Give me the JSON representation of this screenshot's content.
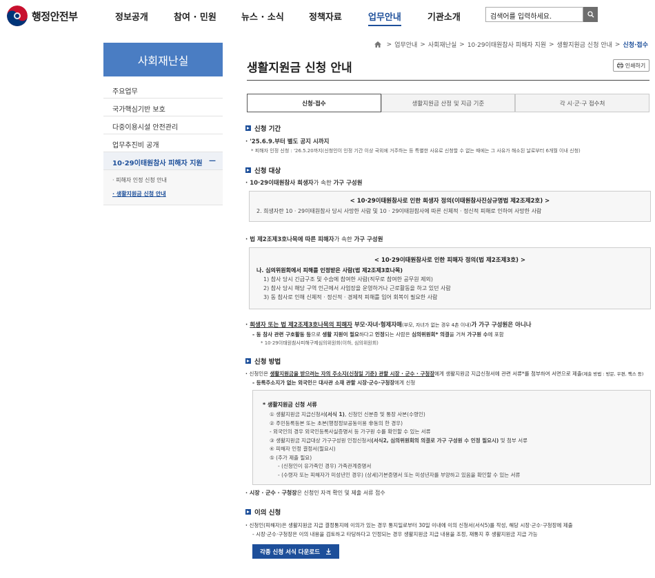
{
  "header": {
    "logo_text": "행정안전부",
    "nav": [
      "정보공개",
      "참여 · 민원",
      "뉴스 · 소식",
      "정책자료",
      "업무안내",
      "기관소개"
    ],
    "active_nav": "업무안내",
    "search_placeholder": "검색어를 입력하세요."
  },
  "sidebar": {
    "title": "사회재난실",
    "items": [
      "주요업무",
      "국가핵심기반 보호",
      "다중이용시설 안전관리",
      "업무추진비 공개"
    ],
    "active_item": "10·29이태원참사 피해자 지원",
    "active_toggle": "—",
    "sub_items": [
      "피해자 인정 신청 안내",
      "생활지원금 신청 안내"
    ]
  },
  "breadcrumb": {
    "items": [
      "업무안내",
      "사회재난실",
      "10·29이태원참사 피해자 지원",
      "생활지원금 신청 안내"
    ],
    "current": "신청·접수",
    "sep": ">"
  },
  "page": {
    "title": "생활지원금 신청 안내",
    "print_label": "인쇄하기"
  },
  "tabs": [
    "신청·접수",
    "생활지원금 산정 및 지급 기준",
    "각 시·군·구 접수처"
  ],
  "content": {
    "s1_title": "신청 기간",
    "s1_line1": "'25.6.9.부터 별도 공지 시까지",
    "s1_note": "* 피해자 인정 신청 : '26.5.20까지(신청인이 인정 기간 이상 국외에 거주하는 등 특별한 사유로 신청할 수 없는 때에는 그 사유가 해소된 날로부터 6개월 이내 신청)",
    "s2_title": "신청 대상",
    "s2_a_pre": "10·29이태원참사 희생자",
    "s2_a_mid": "가 속한 ",
    "s2_a_bold": "가구 구성원",
    "box1_head": "< 10·29이태원참사로 인한 희생자 정의(이태원참사진상규명법 제2조제2호) >",
    "box1_line": "2. 희생자란 10 · 29이태원참사 당시 사망한 사람 및 10 · 29이태원참사에 따른 신체적 · 정신적 피해로 인하여 사망한 사람",
    "s2_b_pre": "법 제2조제3호나목에 따른 피해자",
    "s2_b_mid": "가 속한 ",
    "s2_b_bold": "가구 구성원",
    "box2_head": "< 10·29이태원참사로 인한 피해자 정의(법 제2조제3호) >",
    "box2_l1": "나. 심의위원회에서 피해를 인정받은 사람(법 제2조제3호나목)",
    "box2_l2": "1) 참사 당시 긴급구조 및 수습에 참여한 사람(직무로 참여한 공무원 제외)",
    "box2_l3": "2) 참사 당시 해당 구역 인근에서 사업장을 운영하거나 근로활동을 하고 있던 사람",
    "box2_l4": "3) 동 참사로 인해 신체적 · 정신적 · 경제적 피해를 입어 회복이 필요한 사람",
    "s2_c_pre": "희생자 또는 법 제2조제3호나목의 피해자",
    "s2_c_mid": " 부모·자녀·형제자매",
    "s2_c_small": "(부모, 자녀가 없는 경우 4촌 이내)",
    "s2_c_end": "가 가구 구성원은 아니나",
    "s2_c_dash_1": "- 동 참사 관련 구호활동 등",
    "s2_c_dash_2": "으로 ",
    "s2_c_dash_3": "생활 지원이 필요",
    "s2_c_dash_4": "하다고 ",
    "s2_c_dash_5": "인정",
    "s2_c_dash_6": "되는 사람은 ",
    "s2_c_dash_7": "심의위원회* 의결",
    "s2_c_dash_8": "을 거쳐 ",
    "s2_c_dash_9": "가구원 수",
    "s2_c_dash_10": "에 포함",
    "s2_c_note": "* 10·29이태원참사피해구제심의위원회(이하, 심의위원회)",
    "s3_title": "신청 방법",
    "s3_l1_a": "신청인은 ",
    "s3_l1_b": "생활지원금을 받으려는 자의 주소지(신청일 기준) 관할 시장 · 군수 · 구청장",
    "s3_l1_c": "에게 생활지원금 지급신청서에 관련 서류*를 첨부하여 서면으로 제출",
    "s3_l1_d": "(제출 방법 : 방문, 우편, 팩스 등)",
    "s3_dash_a": "- 등록주소지가 없는 외국인",
    "s3_dash_b": "은 ",
    "s3_dash_c": "대사관 소재 관할 시장·군수·구청장",
    "s3_dash_d": "에게 신청",
    "box3_head": "* 생활지원금 신청 서류",
    "box3_l1_a": "① 생활지원금 지급신청서",
    "box3_l1_b": "(서식 1)",
    "box3_l1_c": ", 신청인 신분증 및 통장 사본(수령인)",
    "box3_l2": "② 주민등록등본 또는 초본(행정정보공동이용 非동의 한 경우)",
    "box3_l3": "- 외국인의 경우 외국인등록사실증명서 등 가구원 수를 확인할 수 있는 서류",
    "box3_l4_a": "③ 생활지원금 지급대상 가구구성원 인정신청서",
    "box3_l4_b": "(서식2, 심의위원회의 의결로 가구 구성원 수 인정 필요시)",
    "box3_l4_c": " 및 첨부 서류",
    "box3_l5": "④ 피해자 인정 결정서(필요시)",
    "box3_l6": "⑤ (추가 제출 필요)",
    "box3_l7": "- (신청인이 유가족인 경우) 가족관계증명서",
    "box3_l8": "- (수령자 또는 피해자가 미성년인 경우) (상세)기본증명서 또는 미성년자를 부양하고 있음을 확인할 수 있는 서류",
    "s3_l2_a": "시장 · 군수 · 구청장",
    "s3_l2_b": "은 신청인 자격 확인 및 제출 서류 접수",
    "s4_title": "이의 신청",
    "s4_l1": "신청인(피해자)은 생활지원금 지급 결정통지에 이의가 있는 경우 통지일로부터 30일 이내에 이의 신청서(서식5)를 작성, 해당 시장·군수·구청장에 제출",
    "s4_dash": "- 시장·군수·구청장은 이의 내용을 검토하고 타당하다고 인정되는 경우 생활지원금 지급 내용을 조정, 재통지 후 생활지원금 지급 가능",
    "download_label": "각종 신청 서식 다운로드"
  },
  "colors": {
    "primary": "#1d4f9a",
    "sidebar_title_bg": "#4a7dc3"
  }
}
